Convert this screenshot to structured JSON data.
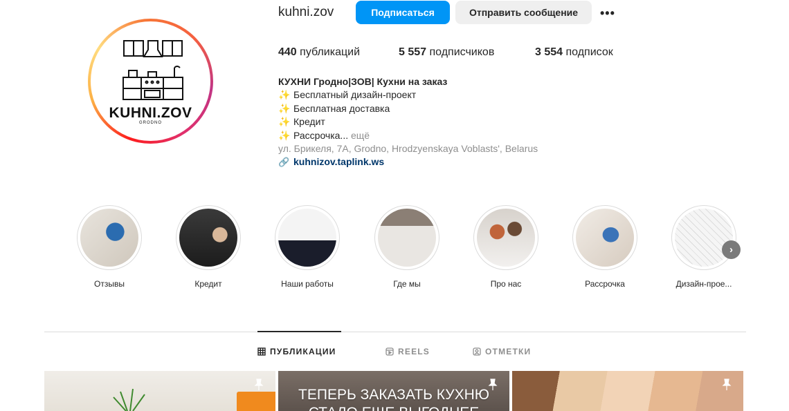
{
  "profile": {
    "username": "kuhni.zov",
    "logo_text": "KUHNI.ZOV",
    "logo_sub": "GRODNO",
    "follow_label": "Подписаться",
    "message_label": "Отправить сообщение",
    "more_label": "•••"
  },
  "stats": {
    "posts_count": "440",
    "posts_label": "публикаций",
    "followers_count": "5 557",
    "followers_label": "подписчиков",
    "following_count": "3 554",
    "following_label": "подписок"
  },
  "bio": {
    "name": "КУХНИ Гродно|ЗОВ| Кухни на заказ",
    "lines": [
      "Бесплатный дизайн-проект",
      "Бесплатная доставка",
      "Кредит",
      "Рассрочка..."
    ],
    "more_label": "ещё",
    "address": "ул. Брикеля, 7А, Grodno, Hrodzyenskaya Voblasts', Belarus",
    "link": "kuhnizov.taplink.ws"
  },
  "highlights": [
    {
      "label": "Отзывы"
    },
    {
      "label": "Кредит"
    },
    {
      "label": "Наши работы"
    },
    {
      "label": "Где мы"
    },
    {
      "label": "Про нас"
    },
    {
      "label": "Рассрочка"
    },
    {
      "label": "Дизайн-прое..."
    }
  ],
  "tabs": [
    {
      "label": "ПУБЛИКАЦИИ",
      "icon": "grid-icon"
    },
    {
      "label": "REELS",
      "icon": "reels-icon"
    },
    {
      "label": "ОТМЕТКИ",
      "icon": "tagged-icon"
    }
  ],
  "posts": [
    {
      "text": ""
    },
    {
      "text": "ТЕПЕРЬ ЗАКАЗАТЬ КУХНЮ СТАЛО ЕЩЕ ВЫГОДНЕЕ"
    },
    {
      "text": ""
    }
  ],
  "colors": {
    "accent": "#0095f6",
    "secondary_btn": "#efefef",
    "link": "#00376b",
    "muted": "#8e8e8e"
  }
}
